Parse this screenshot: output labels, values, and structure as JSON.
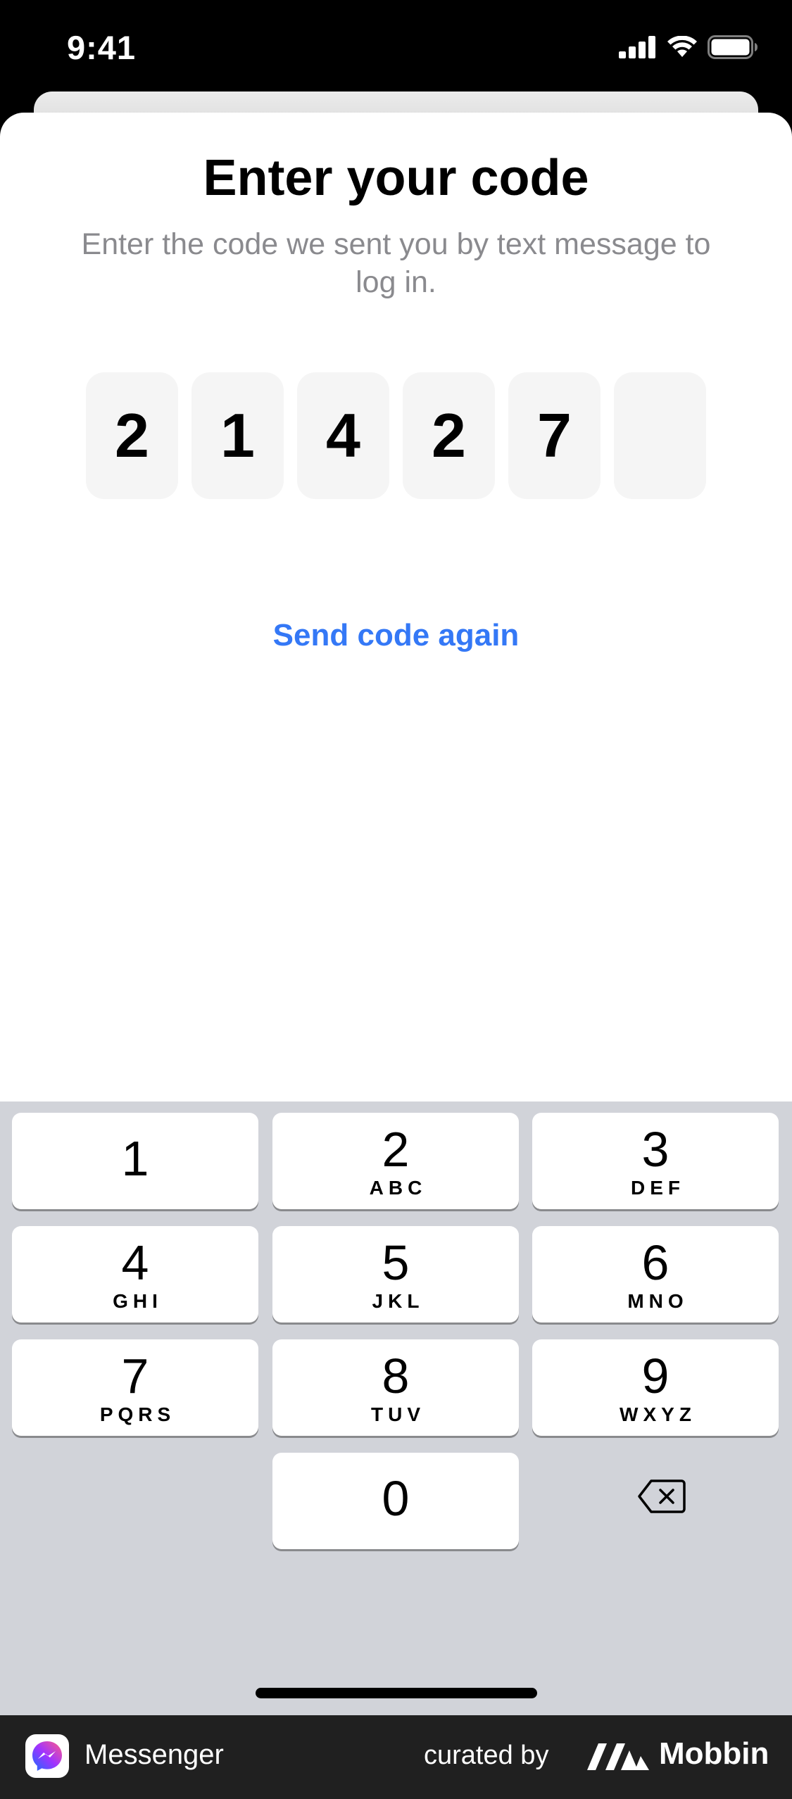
{
  "status_bar": {
    "time": "9:41"
  },
  "header": {
    "title": "Enter your code",
    "subtitle": "Enter the code we sent you by text message to log in."
  },
  "code": {
    "digits": [
      "2",
      "1",
      "4",
      "2",
      "7",
      ""
    ]
  },
  "resend_label": "Send code again",
  "keypad": {
    "keys": [
      {
        "num": "1",
        "letters": ""
      },
      {
        "num": "2",
        "letters": "ABC"
      },
      {
        "num": "3",
        "letters": "DEF"
      },
      {
        "num": "4",
        "letters": "GHI"
      },
      {
        "num": "5",
        "letters": "JKL"
      },
      {
        "num": "6",
        "letters": "MNO"
      },
      {
        "num": "7",
        "letters": "PQRS"
      },
      {
        "num": "8",
        "letters": "TUV"
      },
      {
        "num": "9",
        "letters": "WXYZ"
      },
      {
        "num": "0",
        "letters": ""
      }
    ],
    "delete_icon": "backspace-icon"
  },
  "footer": {
    "app_name": "Messenger",
    "curated_by": "curated by",
    "brand": "Mobbin"
  },
  "colors": {
    "link": "#3478f6",
    "code_box_bg": "#f5f5f5",
    "keyboard_bg": "#d1d3d9",
    "footer_bg": "#202020"
  }
}
